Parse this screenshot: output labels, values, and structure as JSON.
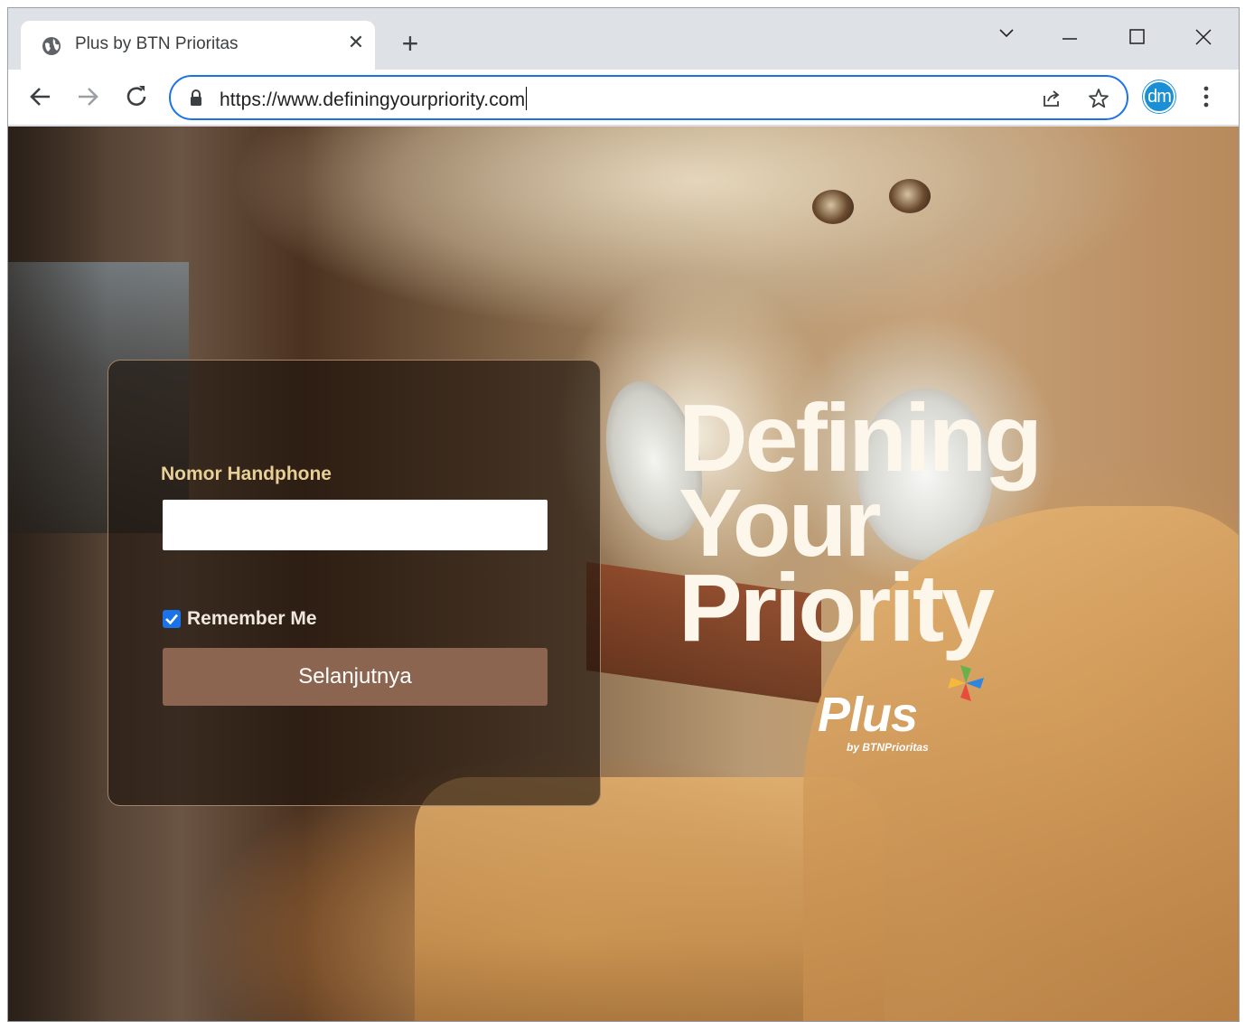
{
  "browser": {
    "tab_title": "Plus by BTN Prioritas",
    "url": "https://www.definingyourpriority.com",
    "profile_initials": "dm",
    "accent_color": "#1a73e8",
    "icons": [
      "globe-icon",
      "close-icon",
      "plus-icon",
      "chevron-down-icon",
      "minimize-icon",
      "maximize-icon",
      "window-close-icon",
      "back-arrow-icon",
      "forward-arrow-icon",
      "reload-icon",
      "lock-icon",
      "share-icon",
      "star-icon",
      "kebab-menu-icon"
    ]
  },
  "login": {
    "phone_label": "Nomor Handphone",
    "phone_value": "",
    "remember_label": "Remember Me",
    "remember_checked": true,
    "submit_label": "Selanjutnya",
    "label_color": "#e8cf96",
    "button_color": "#8c6550"
  },
  "hero": {
    "line1": "Defining",
    "line2": "Your",
    "line3": "Priority",
    "logo_text": "Plus",
    "logo_sub": "by BTNPrioritas"
  }
}
